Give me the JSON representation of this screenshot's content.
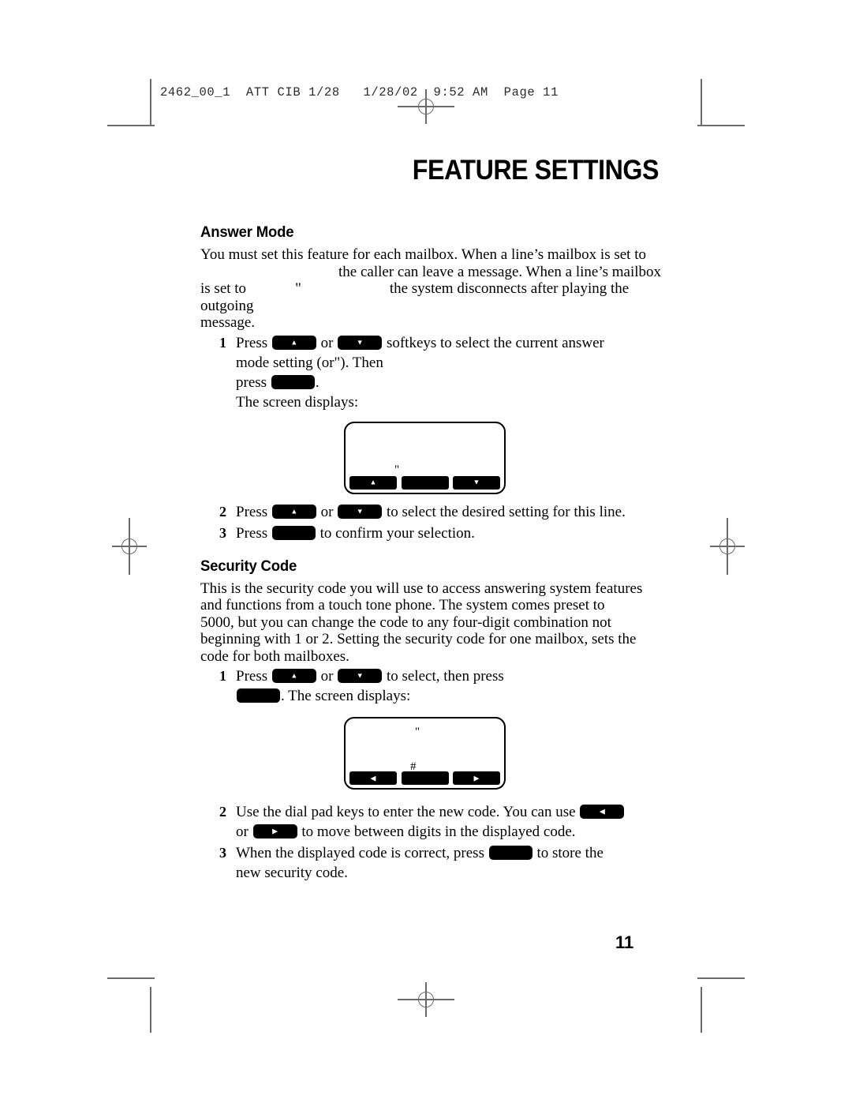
{
  "print_marks": {
    "slug_line": "2462_00_1  ATT CIB 1/28   1/28/02  9:52 AM  Page 11"
  },
  "page": {
    "title": "FEATURE SETTINGS",
    "folio": "11"
  },
  "sections": [
    {
      "heading": "Answer Mode",
      "intro_line_1": "You must set this feature for each mailbox. When a line’s mailbox is set to",
      "intro_line_2": "the caller can leave a message. When a line’s mailbox",
      "intro_line_3a": "is set to",
      "intro_line_3b": "\"",
      "intro_line_3c": "the system disconnects after playing the outgoing",
      "intro_line_4": "message.",
      "steps": [
        {
          "num": "1",
          "t1": "Press",
          "t2": "or",
          "t3": "softkeys to select the current answer",
          "t4": "mode setting (",
          "t5": "or",
          "t6": "\"",
          "t7": "). Then",
          "t8": "press",
          "t9": ".",
          "t10": "The screen displays:"
        },
        {
          "num": "2",
          "t1": "Press",
          "t2": "or",
          "t3": "to select the desired setting for this line."
        },
        {
          "num": "3",
          "t1": "Press",
          "t2": "to confirm your selection."
        }
      ],
      "lcd": {
        "display_text": "\"",
        "softkeys": [
          {
            "glyph": "▲",
            "name": "lcd-softkey-up"
          },
          {
            "glyph": "",
            "name": "lcd-softkey-middle"
          },
          {
            "glyph": "▼",
            "name": "lcd-softkey-down"
          }
        ]
      }
    },
    {
      "heading": "Security Code",
      "body_line_1": "This is the security code you will use to access answering system features",
      "body_line_2": "and functions from a touch tone phone. The system comes preset to",
      "body_line_3": "5000, but you  can change the code to any four-digit combination not",
      "body_line_4": "beginning with 1 or 2. Setting the security code for one mailbox, sets the",
      "body_line_5": "code for both mailboxes.",
      "steps": [
        {
          "num": "1",
          "t1": "Press",
          "t2": "or",
          "t3": "to select",
          "t4": ", then press",
          "t5": ". The screen displays:"
        },
        {
          "num": "2",
          "t1": "Use the dial pad keys to enter the new code. You can use",
          "t2": "or",
          "t3": "to move between digits in the displayed code."
        },
        {
          "num": "3",
          "t1": "When the displayed code is correct, press",
          "t2": "to store the",
          "t3": "new security code."
        }
      ],
      "lcd": {
        "display_text_top": "\"",
        "display_text_mid": "#",
        "softkeys": [
          {
            "glyph": "◀",
            "name": "lcd-softkey-left"
          },
          {
            "glyph": "",
            "name": "lcd-softkey-middle"
          },
          {
            "glyph": "▶",
            "name": "lcd-softkey-right"
          }
        ]
      }
    }
  ],
  "glyphs": {
    "up": "▲",
    "down": "▼",
    "left": "◀",
    "right": "▶",
    "blank": ""
  }
}
